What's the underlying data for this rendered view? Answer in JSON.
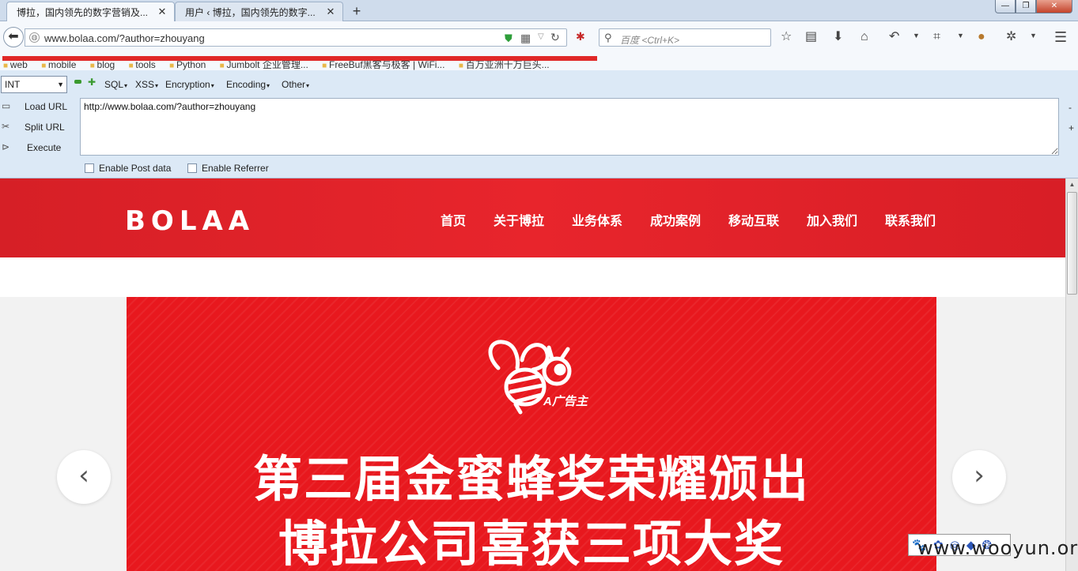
{
  "browser": {
    "tabs": [
      {
        "title": "博拉，国内领先的数字营销及...",
        "close": "✕"
      },
      {
        "title": "用户 ‹ 博拉，国内领先的数字...",
        "close": "✕"
      }
    ],
    "new_tab": "+",
    "window_controls": {
      "minimize": "—",
      "maximize": "❐",
      "close": "✕"
    },
    "url": "www.bolaa.com/?author=zhouyang",
    "search_placeholder": "百度 <Ctrl+K>",
    "bookmarks": [
      "web",
      "mobile",
      "blog",
      "tools",
      "Python",
      "Jumbolt 企业管理...",
      "FreeBuf黑客与极客 | WiFi...",
      "百万亚洲十万巨头..."
    ]
  },
  "hackbar": {
    "select_value": "INT",
    "menus": [
      "SQL",
      "XSS",
      "Encryption",
      "Encoding",
      "Other"
    ],
    "actions": {
      "load": "Load URL",
      "split": "Split URL",
      "execute": "Execute"
    },
    "textarea_value": "http://www.bolaa.com/?author=zhouyang",
    "side_minus": "-",
    "side_plus": "+",
    "checkbox_post": "Enable Post data",
    "checkbox_referrer": "Enable Referrer"
  },
  "site": {
    "logo": "BOLAA",
    "nav": [
      "首页",
      "关于博拉",
      "业务体系",
      "成功案例",
      "移动互联",
      "加入我们",
      "联系我们"
    ],
    "banner": {
      "brand": "A广告主",
      "headline_1": "第三届金蜜蜂奖荣耀颁出",
      "headline_2": "博拉公司喜获三项大奖"
    },
    "arrow_prev": "‹",
    "arrow_next": "›"
  },
  "watermark": {
    "icons": "🐾 ✿ ◎ ◆ ❂",
    "text": "www.wooyun.org"
  },
  "colors": {
    "brand_red": "#e8252c",
    "hackbar_bg": "#dce9f6",
    "tab_strip": "#cfdcec"
  }
}
